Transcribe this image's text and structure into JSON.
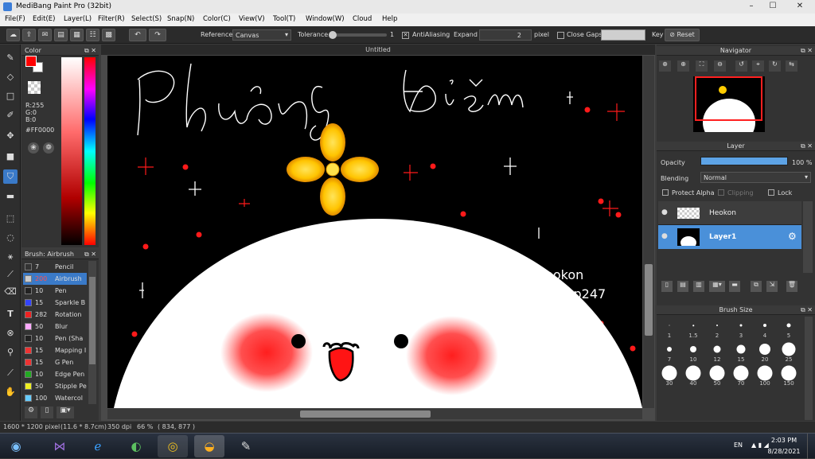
{
  "titlebar": {
    "title": "MediBang Paint Pro (32bit)",
    "minimize": "–",
    "maximize": "☐",
    "close": "✕"
  },
  "menu": [
    "File(F)",
    "Edit(E)",
    "Layer(L)",
    "Filter(R)",
    "Select(S)",
    "Snap(N)",
    "Color(C)",
    "View(V)",
    "Tool(T)",
    "Window(W)",
    "Cloud",
    "Help"
  ],
  "toolbar": {
    "reference_label": "Reference",
    "reference_value": "Canvas",
    "tolerance_label": "Tolerance",
    "tolerance_value": "1",
    "antialiasing_label": "AntiAliasing",
    "antialiasing_checked": true,
    "expand_label": "Expand",
    "expand_value": "2",
    "expand_unit": "pixel",
    "close_gaps_label": "Close Gaps",
    "close_gaps_checked": false,
    "key_label": "Key",
    "reset_label": "Reset"
  },
  "color_panel": {
    "title": "Color",
    "r": "R:255",
    "g": "G:0",
    "b": "B:0",
    "hex": "#FF0000",
    "fg_color": "#ff0000",
    "bg_color": "#ffffff"
  },
  "brush_panel": {
    "title": "Brush: Airbrush",
    "items": [
      {
        "size": "7",
        "name": "Pencil",
        "color": "#333333"
      },
      {
        "size": "200",
        "name": "Airbrush",
        "color": "#cccccc",
        "selected": true
      },
      {
        "size": "10",
        "name": "Pen",
        "color": "#222222"
      },
      {
        "size": "15",
        "name": "Sparkle B",
        "color": "#3344ff"
      },
      {
        "size": "282",
        "name": "Rotation",
        "color": "#ee2222"
      },
      {
        "size": "50",
        "name": "Blur",
        "color": "#ffaaff"
      },
      {
        "size": "10",
        "name": "Pen (Sha",
        "color": "#222222"
      },
      {
        "size": "15",
        "name": "Mapping I",
        "color": "#ee3333"
      },
      {
        "size": "15",
        "name": "G Pen",
        "color": "#ee3333"
      },
      {
        "size": "10",
        "name": "Edge Pen",
        "color": "#22aa22"
      },
      {
        "size": "50",
        "name": "Stipple Pe",
        "color": "#eeee22"
      },
      {
        "size": "100",
        "name": "Watercol",
        "color": "#66ccff"
      }
    ]
  },
  "canvas": {
    "tab_title": "Untitled",
    "title_text_left": "Phương",
    "title_text_right": "Điểm",
    "signature_line1": "Heokon",
    "signature_line2": "#hoidap247"
  },
  "navigator": {
    "title": "Navigator"
  },
  "layer_panel": {
    "title": "Layer",
    "opacity_label": "Opacity",
    "opacity_value": "100 %",
    "opacity_fraction": 1.0,
    "blending_label": "Blending",
    "blending_value": "Normal",
    "protect_alpha": "Protect Alpha",
    "clipping": "Clipping",
    "lock": "Lock",
    "layers": [
      {
        "name": "Heokon",
        "selected": false
      },
      {
        "name": "Layer1",
        "selected": true
      }
    ]
  },
  "brush_size_panel": {
    "title": "Brush Size",
    "sizes": [
      "1",
      "1.5",
      "2",
      "3",
      "4",
      "5",
      "7",
      "10",
      "12",
      "15",
      "20",
      "25",
      "30",
      "40",
      "50",
      "70",
      "100",
      "150"
    ]
  },
  "statusbar": {
    "dims": "1600 * 1200 pixel",
    "cm": "(11.6 * 8.7cm)",
    "dpi": "350 dpi",
    "zoom": "66 %",
    "coords": "( 834, 877 )"
  },
  "taskbar": {
    "lang": "EN",
    "time": "2:03 PM",
    "date": "8/28/2021"
  }
}
